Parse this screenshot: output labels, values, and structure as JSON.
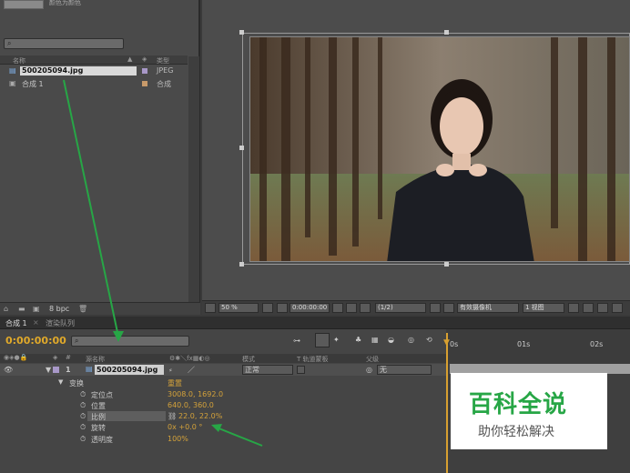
{
  "project": {
    "color_label": "颜色为颜色",
    "header_name": "名称",
    "header_type": "类型",
    "items": [
      {
        "name": "500205094.jpg",
        "type": "JPEG"
      },
      {
        "name": "合成 1",
        "type": "合成"
      }
    ],
    "bpc": "8 bpc"
  },
  "comp_footer": {
    "zoom": "50 %",
    "timecode": "0:00:00:00",
    "resolution": "(1/2)",
    "camera": "有效摄像机",
    "views": "1 视图"
  },
  "timeline": {
    "tabs": [
      "合成 1",
      "渲染队列"
    ],
    "timecode": "0:00:00:00",
    "header_source": "源名称",
    "header_mode": "模式",
    "header_trkmat": "T  轨道蒙板",
    "header_parent": "父级",
    "layer": {
      "index": "1",
      "name": "500205094.jpg",
      "mode": "正常",
      "parent": "无"
    },
    "transform_label": "变换",
    "reset_label": "重置",
    "properties": [
      {
        "name": "定位点",
        "value": "3008.0, 1692.0"
      },
      {
        "name": "位置",
        "value": "640.0, 360.0"
      },
      {
        "name": "比例",
        "value": "22.0, 22.0%"
      },
      {
        "name": "旋转",
        "value": "0x +0.0 °"
      },
      {
        "name": "透明度",
        "value": "100%"
      }
    ],
    "ruler": [
      "0s",
      "01s",
      "02s"
    ]
  },
  "watermark": {
    "title": "百科全说",
    "subtitle": "助你轻松解决"
  },
  "colors": {
    "accent_orange": "#e0a92a",
    "arrow_green": "#27a646"
  }
}
